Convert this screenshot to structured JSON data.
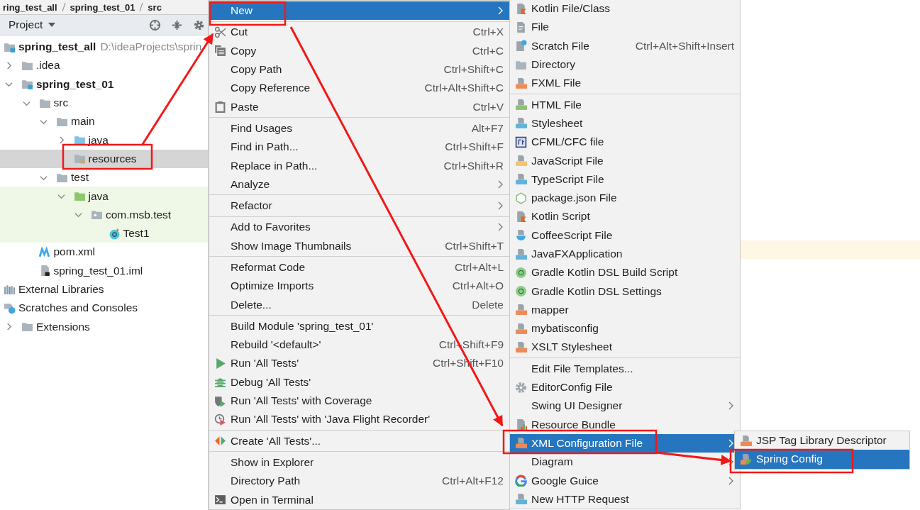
{
  "breadcrumb": [
    "ring_test_all",
    "spring_test_01",
    "src"
  ],
  "project_panel": {
    "title": "Project",
    "tree": [
      {
        "label": "spring_test_all",
        "kind": "module",
        "bold": true,
        "path": "D:\\ideaProjects\\sprin",
        "selected": false,
        "test_scope": false,
        "children": [
          {
            "label": ".idea",
            "kind": "folder",
            "bold": false,
            "expanded": false,
            "selected": false,
            "test_scope": false
          },
          {
            "label": "spring_test_01",
            "kind": "module",
            "bold": true,
            "expanded": true,
            "selected": false,
            "test_scope": false,
            "children": [
              {
                "label": "src",
                "kind": "folder",
                "bold": false,
                "expanded": true,
                "selected": false,
                "test_scope": false,
                "children": [
                  {
                    "label": "main",
                    "kind": "folder",
                    "bold": false,
                    "expanded": true,
                    "selected": false,
                    "test_scope": false,
                    "children": [
                      {
                        "label": "java",
                        "kind": "source",
                        "bold": false,
                        "expanded": false,
                        "selected": false,
                        "test_scope": false
                      },
                      {
                        "label": "resources",
                        "kind": "resources",
                        "bold": false,
                        "selected": true,
                        "test_scope": false
                      }
                    ]
                  },
                  {
                    "label": "test",
                    "kind": "folder",
                    "bold": false,
                    "expanded": true,
                    "selected": false,
                    "test_scope": false,
                    "children": [
                      {
                        "label": "java",
                        "kind": "test-source",
                        "bold": false,
                        "expanded": true,
                        "selected": false,
                        "test_scope": true,
                        "children": [
                          {
                            "label": "com.msb.test",
                            "kind": "package",
                            "bold": false,
                            "expanded": true,
                            "selected": false,
                            "test_scope": true,
                            "children": [
                              {
                                "label": "Test1",
                                "kind": "class",
                                "bold": false,
                                "selected": false,
                                "test_scope": true
                              }
                            ]
                          }
                        ]
                      }
                    ]
                  }
                ]
              },
              {
                "label": "pom.xml",
                "kind": "maven",
                "bold": false,
                "selected": false,
                "test_scope": false
              },
              {
                "label": "spring_test_01.iml",
                "kind": "iml",
                "bold": false,
                "selected": false,
                "test_scope": false
              }
            ]
          }
        ]
      },
      {
        "label": "External Libraries",
        "kind": "libraries",
        "bold": false,
        "selected": false,
        "test_scope": false
      },
      {
        "label": "Scratches and Consoles",
        "kind": "scratches",
        "bold": false,
        "selected": false,
        "test_scope": false,
        "children": [
          {
            "label": "Extensions",
            "kind": "folder",
            "bold": false,
            "expanded": false,
            "selected": false,
            "test_scope": false
          }
        ]
      }
    ]
  },
  "context_menu": {
    "sections": [
      [
        {
          "label": "New",
          "submenu": true,
          "selected": true
        }
      ],
      [
        {
          "label": "Cut",
          "shortcut": "Ctrl+X",
          "kind": "scissors",
          "submenu": false,
          "selected": false
        },
        {
          "label": "Copy",
          "shortcut": "Ctrl+C",
          "kind": "copy",
          "submenu": false,
          "selected": false
        },
        {
          "label": "Copy Path",
          "shortcut": "Ctrl+Shift+C",
          "submenu": false,
          "selected": false
        },
        {
          "label": "Copy Reference",
          "shortcut": "Ctrl+Alt+Shift+C",
          "submenu": false,
          "selected": false
        },
        {
          "label": "Paste",
          "shortcut": "Ctrl+V",
          "kind": "paste",
          "submenu": false,
          "selected": false
        }
      ],
      [
        {
          "label": "Find Usages",
          "shortcut": "Alt+F7",
          "submenu": false,
          "selected": false
        },
        {
          "label": "Find in Path...",
          "shortcut": "Ctrl+Shift+F",
          "submenu": false,
          "selected": false
        },
        {
          "label": "Replace in Path...",
          "shortcut": "Ctrl+Shift+R",
          "submenu": false,
          "selected": false
        },
        {
          "label": "Analyze",
          "submenu": true,
          "selected": false
        }
      ],
      [
        {
          "label": "Refactor",
          "submenu": true,
          "selected": false
        }
      ],
      [
        {
          "label": "Add to Favorites",
          "submenu": true,
          "selected": false
        },
        {
          "label": "Show Image Thumbnails",
          "shortcut": "Ctrl+Shift+T",
          "submenu": false,
          "selected": false
        }
      ],
      [
        {
          "label": "Reformat Code",
          "shortcut": "Ctrl+Alt+L",
          "submenu": false,
          "selected": false
        },
        {
          "label": "Optimize Imports",
          "shortcut": "Ctrl+Alt+O",
          "submenu": false,
          "selected": false
        },
        {
          "label": "Delete...",
          "shortcut": "Delete",
          "submenu": false,
          "selected": false
        }
      ],
      [
        {
          "label": "Build Module 'spring_test_01'",
          "submenu": false,
          "selected": false
        },
        {
          "label": "Rebuild '<default>'",
          "shortcut": "Ctrl+Shift+F9",
          "submenu": false,
          "selected": false
        },
        {
          "label": "Run 'All Tests'",
          "shortcut": "Ctrl+Shift+F10",
          "kind": "play",
          "submenu": false,
          "selected": false
        },
        {
          "label": "Debug 'All Tests'",
          "kind": "bug",
          "submenu": false,
          "selected": false
        },
        {
          "label": "Run 'All Tests' with Coverage",
          "kind": "shield",
          "submenu": false,
          "selected": false
        },
        {
          "label": "Run 'All Tests' with 'Java Flight Recorder'",
          "kind": "clock",
          "submenu": false,
          "selected": false
        }
      ],
      [
        {
          "label": "Create 'All Tests'...",
          "kind": "diamond",
          "submenu": false,
          "selected": false
        }
      ],
      [
        {
          "label": "Show in Explorer",
          "submenu": false,
          "selected": false
        },
        {
          "label": "Directory Path",
          "shortcut": "Ctrl+Alt+F12",
          "submenu": false,
          "selected": false
        },
        {
          "label": "Open in Terminal",
          "kind": "terminal",
          "submenu": false,
          "selected": false
        }
      ]
    ]
  },
  "new_submenu": {
    "sections": [
      [
        {
          "label": "Kotlin File/Class",
          "kind": "kotlin",
          "submenu": false,
          "selected": false
        },
        {
          "label": "File",
          "kind": "file",
          "submenu": false,
          "selected": false
        },
        {
          "label": "Scratch File",
          "shortcut": "Ctrl+Alt+Shift+Insert",
          "kind": "scratch",
          "submenu": false,
          "selected": false
        },
        {
          "label": "Directory",
          "kind": "folder",
          "submenu": false,
          "selected": false
        },
        {
          "label": "FXML File",
          "kind": "xml",
          "submenu": false,
          "selected": false
        }
      ],
      [
        {
          "label": "HTML File",
          "kind": "html",
          "submenu": false,
          "selected": false
        },
        {
          "label": "Stylesheet",
          "kind": "css",
          "submenu": false,
          "selected": false
        },
        {
          "label": "CFML/CFC file",
          "kind": "cfml",
          "submenu": false,
          "selected": false
        },
        {
          "label": "JavaScript File",
          "kind": "js",
          "submenu": false,
          "selected": false
        },
        {
          "label": "TypeScript File",
          "kind": "ts",
          "submenu": false,
          "selected": false
        },
        {
          "label": "package.json File",
          "kind": "hex",
          "submenu": false,
          "selected": false
        },
        {
          "label": "Kotlin Script",
          "kind": "kotlin",
          "submenu": false,
          "selected": false
        },
        {
          "label": "CoffeeScript File",
          "kind": "coffee",
          "submenu": false,
          "selected": false
        },
        {
          "label": "JavaFXApplication",
          "kind": "javafx",
          "submenu": false,
          "selected": false
        },
        {
          "label": "Gradle Kotlin DSL Build Script",
          "kind": "gradle",
          "submenu": false,
          "selected": false
        },
        {
          "label": "Gradle Kotlin DSL Settings",
          "kind": "gradle",
          "submenu": false,
          "selected": false
        },
        {
          "label": "mapper",
          "kind": "xml",
          "submenu": false,
          "selected": false
        },
        {
          "label": "mybatisconfig",
          "kind": "xml",
          "submenu": false,
          "selected": false
        },
        {
          "label": "XSLT Stylesheet",
          "kind": "xml",
          "submenu": false,
          "selected": false
        }
      ],
      [
        {
          "label": "Edit File Templates...",
          "submenu": false,
          "selected": false
        },
        {
          "label": "EditorConfig File",
          "kind": "gear",
          "submenu": false,
          "selected": false
        },
        {
          "label": "Swing UI Designer",
          "submenu": true,
          "selected": false
        },
        {
          "label": "Resource Bundle",
          "kind": "bundle",
          "submenu": false,
          "selected": false
        },
        {
          "label": "XML Configuration File",
          "kind": "xml",
          "submenu": true,
          "selected": true
        },
        {
          "label": "Diagram",
          "submenu": true,
          "selected": false
        },
        {
          "label": "Google Guice",
          "kind": "google",
          "submenu": true,
          "selected": false
        },
        {
          "label": "New HTTP Request",
          "kind": "api",
          "submenu": false,
          "selected": false
        }
      ]
    ]
  },
  "xml_submenu": {
    "items": [
      {
        "label": "JSP Tag Library Descriptor",
        "kind": "xml",
        "selected": false
      },
      {
        "label": "Spring Config",
        "kind": "spring",
        "selected": true
      }
    ]
  }
}
